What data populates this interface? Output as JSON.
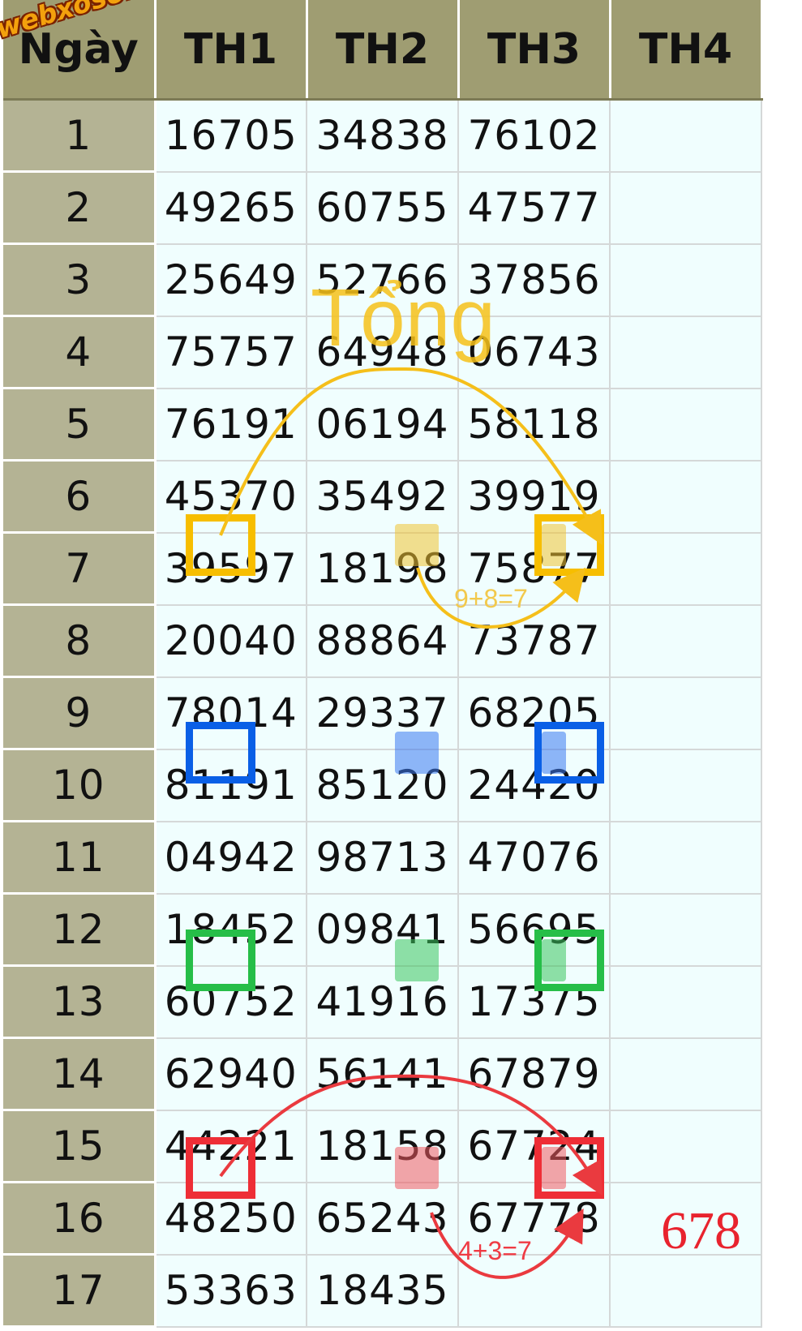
{
  "table": {
    "headers": [
      "Ngày",
      "TH1",
      "TH2",
      "TH3",
      "TH4"
    ],
    "rows": [
      {
        "day": "1",
        "th1": "16705",
        "th2": "34838",
        "th3": "76102",
        "th4": ""
      },
      {
        "day": "2",
        "th1": "49265",
        "th2": "60755",
        "th3": "47577",
        "th4": ""
      },
      {
        "day": "3",
        "th1": "25649",
        "th2": "52766",
        "th3": "37856",
        "th4": ""
      },
      {
        "day": "4",
        "th1": "75757",
        "th2": "64948",
        "th3": "06743",
        "th4": ""
      },
      {
        "day": "5",
        "th1": "76191",
        "th2": "06194",
        "th3": "58118",
        "th4": ""
      },
      {
        "day": "6",
        "th1": "45370",
        "th2": "35492",
        "th3": "39919",
        "th4": ""
      },
      {
        "day": "7",
        "th1": "39597",
        "th2": "18198",
        "th3": "75877",
        "th4": ""
      },
      {
        "day": "8",
        "th1": "20040",
        "th2": "88864",
        "th3": "73787",
        "th4": ""
      },
      {
        "day": "9",
        "th1": "78014",
        "th2": "29337",
        "th3": "68205",
        "th4": ""
      },
      {
        "day": "10",
        "th1": "81191",
        "th2": "85120",
        "th3": "24420",
        "th4": ""
      },
      {
        "day": "11",
        "th1": "04942",
        "th2": "98713",
        "th3": "47076",
        "th4": ""
      },
      {
        "day": "12",
        "th1": "18452",
        "th2": "09841",
        "th3": "56695",
        "th4": ""
      },
      {
        "day": "13",
        "th1": "60752",
        "th2": "41916",
        "th3": "17375",
        "th4": ""
      },
      {
        "day": "14",
        "th1": "62940",
        "th2": "56141",
        "th3": "67879",
        "th4": ""
      },
      {
        "day": "15",
        "th1": "44221",
        "th2": "18158",
        "th3": "67724",
        "th4": ""
      },
      {
        "day": "16",
        "th1": "48250",
        "th2": "65243",
        "th3": "67778",
        "th4": ""
      },
      {
        "day": "17",
        "th1": "53363",
        "th2": "18435",
        "th3": "",
        "th4": ""
      }
    ]
  },
  "annotations": {
    "tong_label": "Tổng",
    "sum_label_1": "9+8=7",
    "sum_label_2": "4+3=7",
    "result_label": "678",
    "watermark": "webxoso.net"
  },
  "colors": {
    "header_bg": "#9f9d72",
    "day_col_bg": "#b4b394",
    "cell_bg": "#f0fefe",
    "yellow": "#f7be00",
    "blue": "#0a5fe6",
    "green": "#26be48",
    "red": "#ee2e36"
  }
}
